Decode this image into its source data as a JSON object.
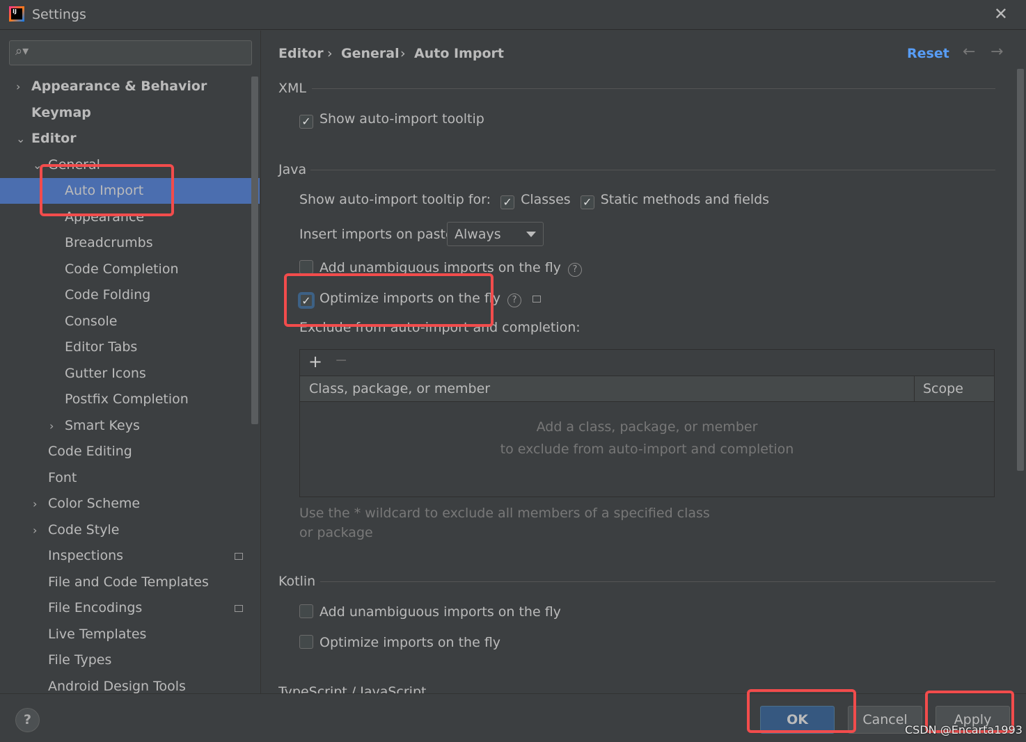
{
  "window": {
    "title": "Settings",
    "logo_text": "IJ"
  },
  "search": {
    "placeholder": ""
  },
  "tree": [
    {
      "label": "Appearance & Behavior",
      "arrow": "›",
      "bold": true
    },
    {
      "label": "Keymap",
      "bold": true
    },
    {
      "label": "Editor",
      "arrow": "⌄",
      "bold": true
    },
    {
      "label": "General",
      "arrow": "⌄"
    },
    {
      "label": "Auto Import",
      "selected": true
    },
    {
      "label": "Appearance"
    },
    {
      "label": "Breadcrumbs"
    },
    {
      "label": "Code Completion"
    },
    {
      "label": "Code Folding"
    },
    {
      "label": "Console"
    },
    {
      "label": "Editor Tabs"
    },
    {
      "label": "Gutter Icons"
    },
    {
      "label": "Postfix Completion"
    },
    {
      "label": "Smart Keys",
      "arrow": "›"
    },
    {
      "label": "Code Editing"
    },
    {
      "label": "Font"
    },
    {
      "label": "Color Scheme",
      "arrow": "›"
    },
    {
      "label": "Code Style",
      "arrow": "›"
    },
    {
      "label": "Inspections"
    },
    {
      "label": "File and Code Templates"
    },
    {
      "label": "File Encodings"
    },
    {
      "label": "Live Templates"
    },
    {
      "label": "File Types"
    },
    {
      "label": "Android Design Tools"
    }
  ],
  "breadcrumb": [
    "Editor",
    "General",
    "Auto Import"
  ],
  "header": {
    "reset": "Reset",
    "back": "←",
    "forward": "→"
  },
  "xml": {
    "title": "XML",
    "show_tooltip": "Show auto-import tooltip"
  },
  "java": {
    "title": "Java",
    "tooltip_for": "Show auto-import tooltip for:",
    "classes": "Classes",
    "static": "Static methods and fields",
    "insert_label": "Insert imports on paste:",
    "insert_value": "Always",
    "add_unambiguous": "Add unambiguous imports on the fly",
    "optimize": "Optimize imports on the fly",
    "exclude_label": "Exclude from auto-import and completion:",
    "add": "+",
    "remove": "−",
    "col1": "Class, package, or member",
    "col2": "Scope",
    "empty1": "Add a class, package, or member",
    "empty2": "to exclude from auto-import and completion",
    "hint": "Use the * wildcard to exclude all members of a specified class or package"
  },
  "kotlin": {
    "title": "Kotlin",
    "add_unambiguous": "Add unambiguous imports on the fly",
    "optimize": "Optimize imports on the fly"
  },
  "next_section": "TypeScript / JavaScript",
  "footer": {
    "help": "?",
    "ok": "OK",
    "cancel": "Cancel",
    "apply": "Apply"
  },
  "watermark": "CSDN @Encarta1993",
  "colors": {
    "selection": "#4b6eaf",
    "link": "#589df6",
    "annotation": "#f24c4c"
  }
}
